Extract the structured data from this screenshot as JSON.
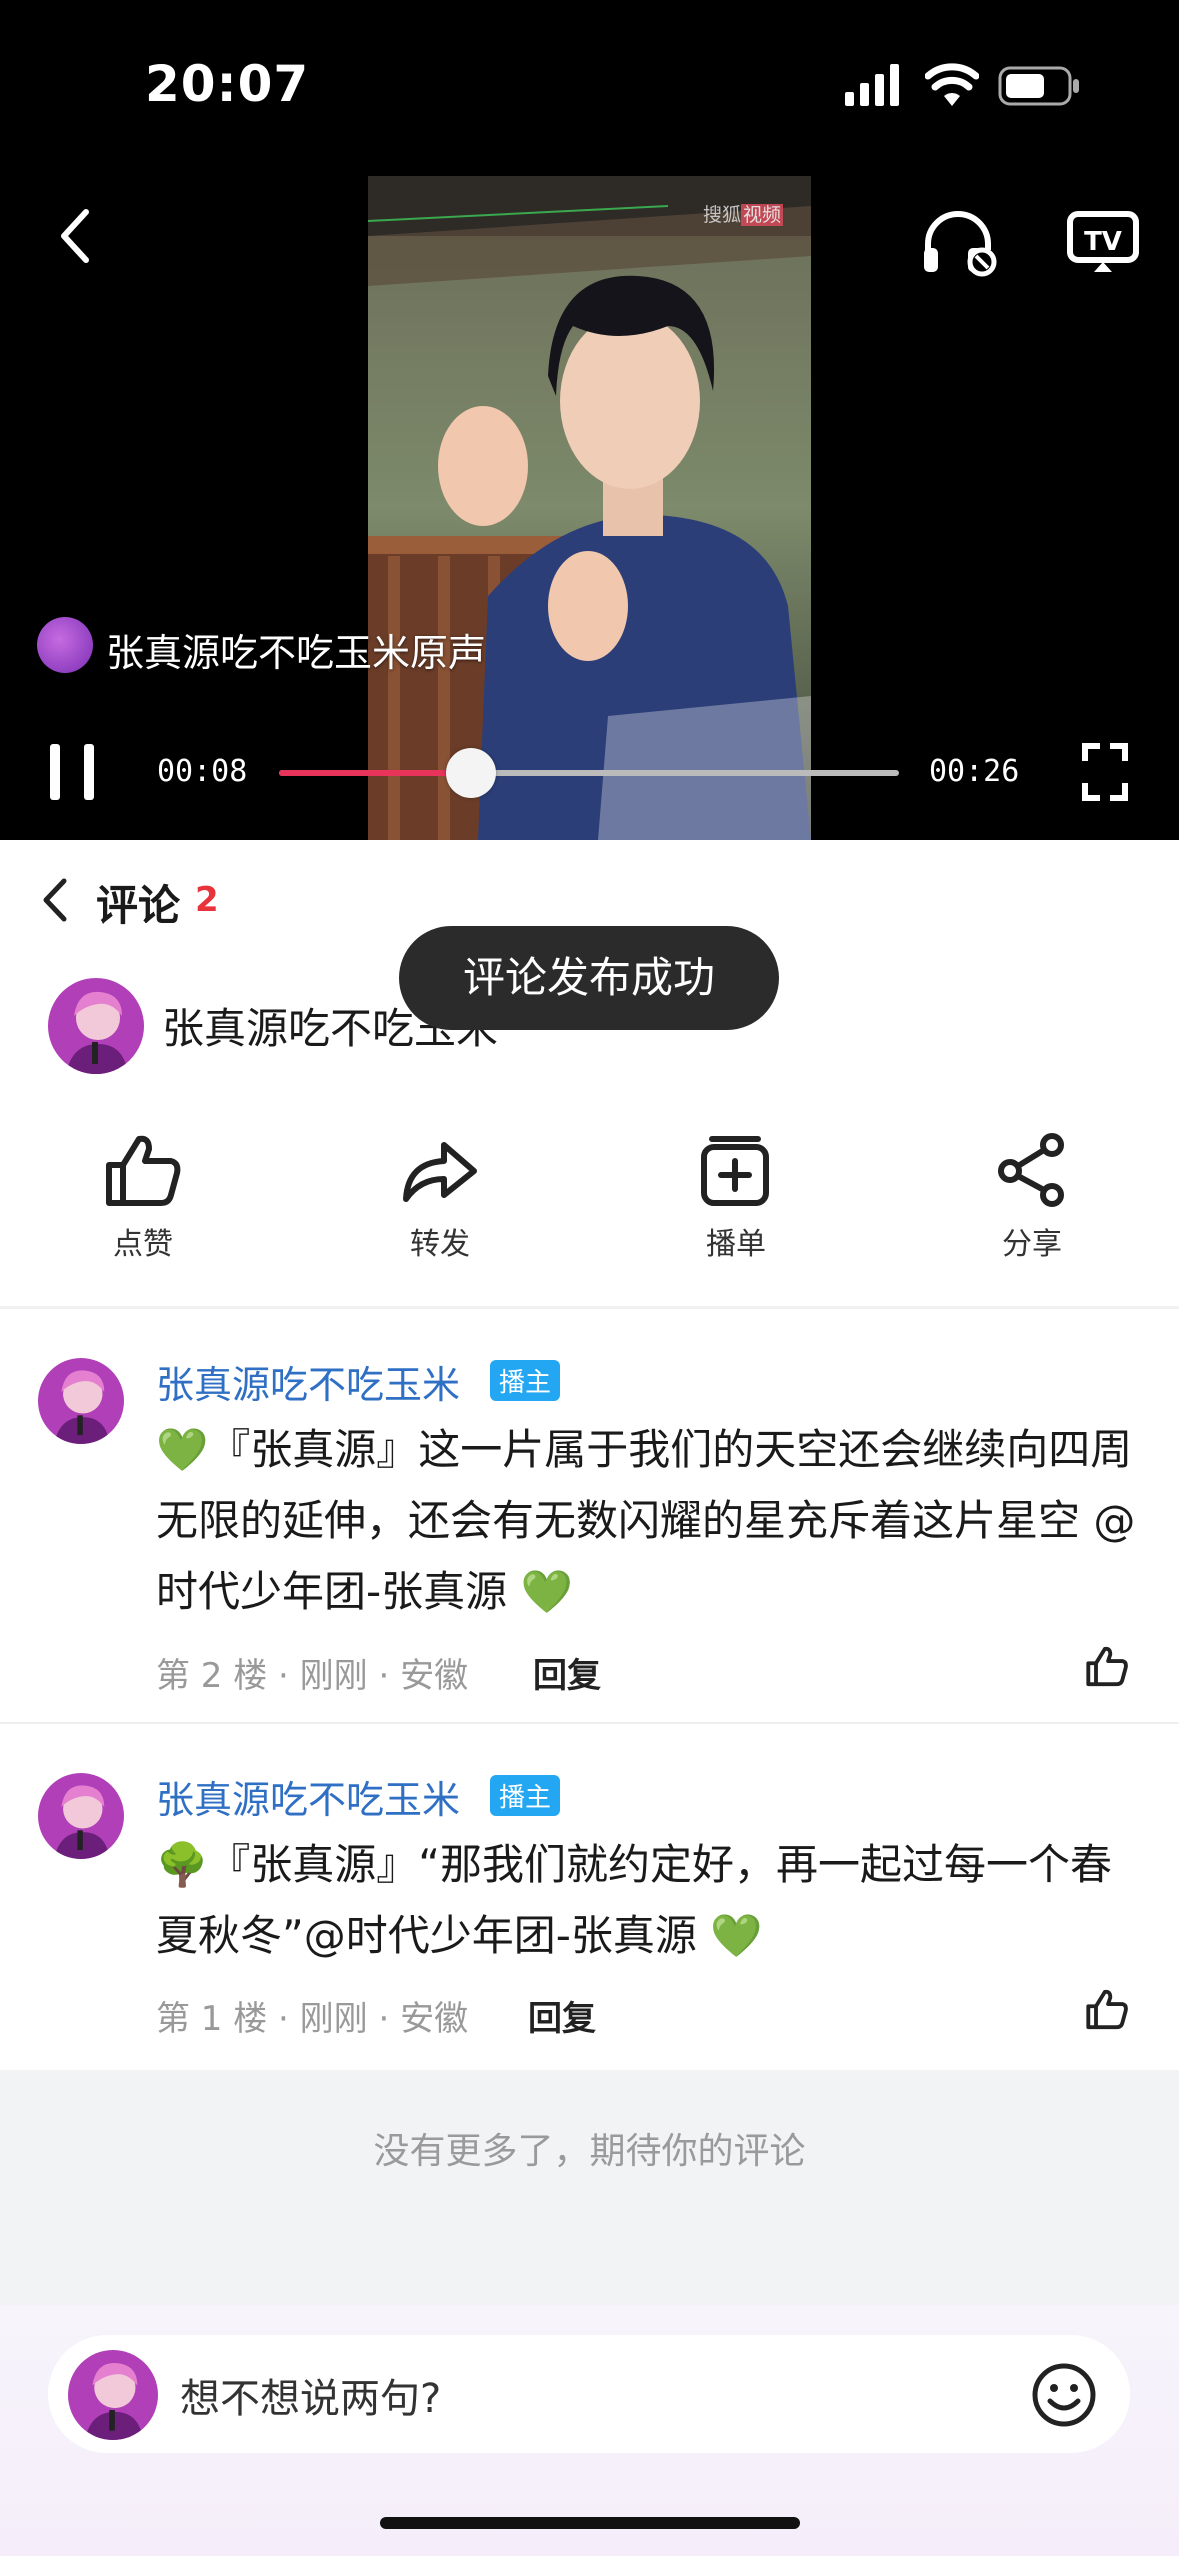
{
  "status_bar": {
    "time": "20:07"
  },
  "player": {
    "audio_title": "张真源吃不吃玉米原声",
    "watermark_a": "搜狐",
    "watermark_b": "视频",
    "current_time": "00:08",
    "total_time": "00:26",
    "progress": 0.31,
    "icons": [
      "back-icon",
      "listen-icon",
      "tv-cast-icon",
      "pause-icon",
      "fullscreen-icon"
    ]
  },
  "comments_header": {
    "title": "评论",
    "count": "2"
  },
  "toast": "评论发布成功",
  "post": {
    "title": "张真源吃不吃玉米"
  },
  "actions": [
    {
      "label": "点赞",
      "icon": "thumbs-up-icon"
    },
    {
      "label": "转发",
      "icon": "forward-icon"
    },
    {
      "label": "播单",
      "icon": "playlist-add-icon"
    },
    {
      "label": "分享",
      "icon": "share-icon"
    }
  ],
  "comments": [
    {
      "user": "张真源吃不吃玉米",
      "badge": "播主",
      "body": "💚『张真源』这一片属于我们的天空还会继续向四周无限的延伸，还会有无数闪耀的星充斥着这片星空 @时代少年团-张真源 💚",
      "meta": "第 2 楼 · 刚刚 · 安徽",
      "reply": "回复"
    },
    {
      "user": "张真源吃不吃玉米",
      "badge": "播主",
      "body": "🌳『张真源』“那我们就约定好，再一起过每一个春夏秋冬”@时代少年团-张真源 💚",
      "meta": "第 1 楼 · 刚刚 · 安徽",
      "reply": "回复"
    }
  ],
  "no_more": "没有更多了，期待你的评论",
  "input": {
    "placeholder": "想不想说两句?"
  },
  "colors": {
    "accent": "#e8335a",
    "name_blue": "#2f6fc4",
    "badge_blue": "#23a7f3",
    "count_red": "#e8333a"
  }
}
